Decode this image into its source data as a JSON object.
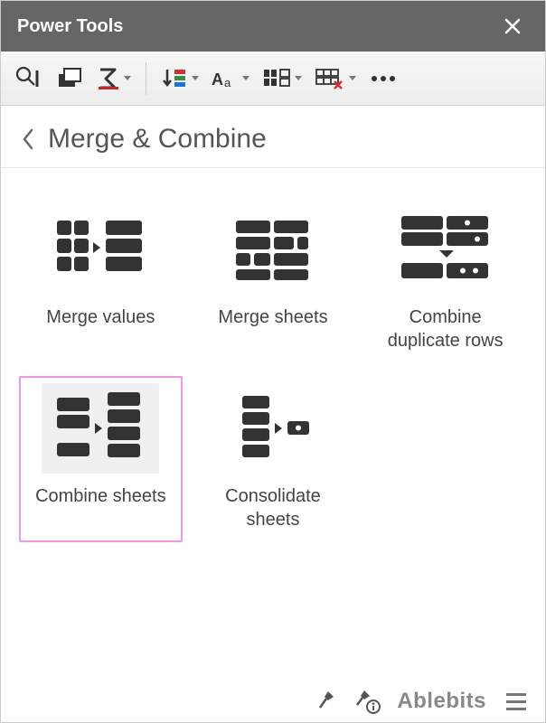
{
  "titlebar": {
    "title": "Power Tools"
  },
  "breadcrumb": {
    "title": "Merge & Combine"
  },
  "tools": [
    {
      "label": "Merge values"
    },
    {
      "label": "Merge sheets"
    },
    {
      "label": "Combine duplicate rows"
    },
    {
      "label": "Combine sheets"
    },
    {
      "label": "Consolidate sheets"
    }
  ],
  "footer": {
    "brand": "Ablebits"
  }
}
